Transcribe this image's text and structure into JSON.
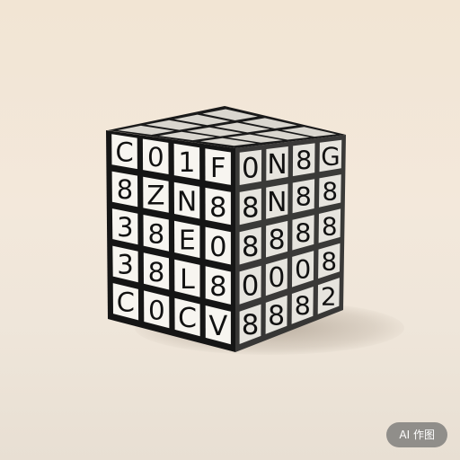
{
  "scene": {
    "subject": "number-cube-puzzle",
    "front_face_rows": [
      [
        "C",
        "0",
        "1",
        "F"
      ],
      [
        "8",
        "Z",
        "N",
        "8"
      ],
      [
        "3",
        "8",
        "E",
        "0"
      ],
      [
        "3",
        "8",
        "L",
        "8"
      ],
      [
        "C",
        "0",
        "C",
        "V"
      ]
    ],
    "side_face_rows": [
      [
        "0",
        "N",
        "8",
        "G"
      ],
      [
        "8",
        "N",
        "8",
        "8"
      ],
      [
        "8",
        "8",
        "8",
        "8"
      ],
      [
        "0",
        "0",
        "0",
        "8"
      ],
      [
        "8",
        "8",
        "8",
        "2"
      ]
    ],
    "colors": {
      "cube_body": "#1c1c1c",
      "tile_face": "#f7f5f0",
      "glyph": "#111111",
      "background": "#f2e6d6"
    }
  },
  "badge": {
    "label": "AI 作图"
  }
}
